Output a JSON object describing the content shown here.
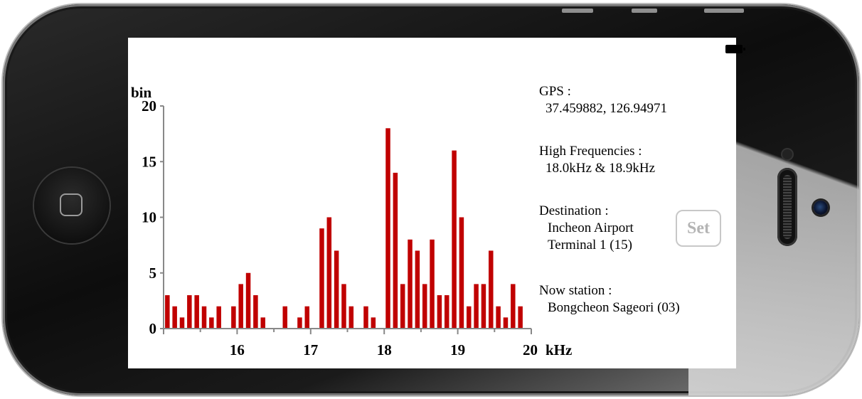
{
  "status_bar": {
    "battery_icon": "battery-full-icon"
  },
  "info": {
    "gps_label": "GPS :",
    "gps_value": "37.459882, 126.94971",
    "freq_label": "High Frequencies :",
    "freq_value": "18.0kHz & 18.9kHz",
    "dest_label": "Destination :",
    "dest_line1": "Incheon Airport",
    "dest_line2": "Terminal 1 (15)",
    "now_label": "Now station :",
    "now_value": "Bongcheon Sageori (03)",
    "set_button_label": "Set"
  },
  "chart_data": {
    "type": "bar",
    "ylabel": "bin",
    "xlabel": "kHz",
    "xlim": [
      15,
      20
    ],
    "ylim": [
      0,
      20
    ],
    "yticks": [
      0,
      5,
      10,
      15,
      20
    ],
    "xticks": [
      16,
      17,
      18,
      19,
      20
    ],
    "bar_color": "#c00000",
    "grid": false,
    "x": [
      15.02,
      15.12,
      15.22,
      15.32,
      15.42,
      15.52,
      15.62,
      15.72,
      15.92,
      16.02,
      16.12,
      16.22,
      16.32,
      16.62,
      16.82,
      16.92,
      17.12,
      17.22,
      17.32,
      17.42,
      17.52,
      17.72,
      17.82,
      18.02,
      18.12,
      18.22,
      18.32,
      18.42,
      18.52,
      18.62,
      18.72,
      18.82,
      18.92,
      19.02,
      19.12,
      19.22,
      19.32,
      19.42,
      19.52,
      19.62,
      19.72,
      19.82
    ],
    "values": [
      3,
      2,
      1,
      3,
      3,
      2,
      1,
      2,
      2,
      4,
      5,
      3,
      1,
      2,
      1,
      2,
      9,
      10,
      7,
      4,
      2,
      2,
      1,
      18,
      14,
      4,
      8,
      7,
      4,
      8,
      3,
      3,
      16,
      10,
      2,
      4,
      4,
      7,
      2,
      1,
      4,
      2
    ]
  }
}
